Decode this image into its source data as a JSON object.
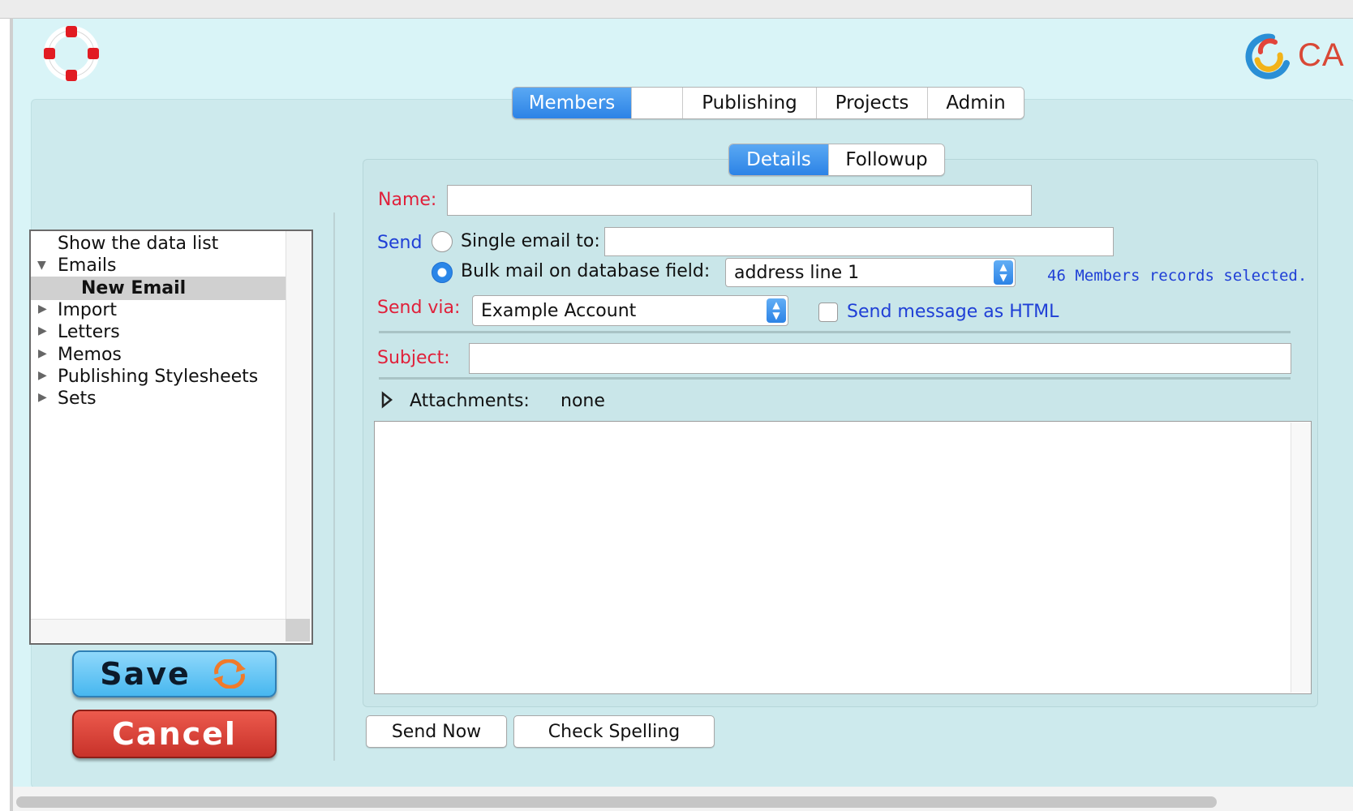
{
  "nav": {
    "tabs": [
      {
        "label": "Members",
        "active": true
      },
      {
        "label": "",
        "active": false
      },
      {
        "label": "Publishing",
        "active": false
      },
      {
        "label": "Projects",
        "active": false
      },
      {
        "label": "Admin",
        "active": false
      }
    ]
  },
  "brand": {
    "text": "CA",
    "icon": "brand-swirl-logo",
    "app_icon": "lifebuoy-icon"
  },
  "subnav": {
    "tabs": [
      {
        "label": "Details",
        "active": true
      },
      {
        "label": "Followup",
        "active": false
      }
    ]
  },
  "tree": {
    "items": [
      {
        "label": "Show the data list",
        "expanded": null
      },
      {
        "label": "Emails",
        "expanded": true
      },
      {
        "label": "New Email",
        "selected": true
      },
      {
        "label": "Import",
        "expanded": false
      },
      {
        "label": "Letters",
        "expanded": false
      },
      {
        "label": "Memos",
        "expanded": false
      },
      {
        "label": "Publishing Stylesheets",
        "expanded": false
      },
      {
        "label": "Sets",
        "expanded": false
      }
    ]
  },
  "form": {
    "name_label": "Name:",
    "name_value": "",
    "send_label": "Send",
    "single_email_label": "Single email to:",
    "single_email_value": "",
    "bulk_label": "Bulk mail on database field:",
    "bulk_field": "address line 1",
    "records_selected": "46 Members records selected.",
    "send_via_label": "Send via:",
    "send_via_value": "Example Account",
    "html_label": "Send message as HTML",
    "html_checked": false,
    "subject_label": "Subject:",
    "subject_value": "",
    "attachments_label": "Attachments:",
    "attachments_value": "none",
    "body": ""
  },
  "buttons": {
    "send_now": "Send Now",
    "check_spelling": "Check Spelling",
    "save": "Save",
    "cancel": "Cancel"
  },
  "colors": {
    "window_bg": "#d9f4f7",
    "label_red": "#e0203a",
    "label_blue": "#1f3fd6",
    "tab_active": "#2c83e6",
    "save_btn": "#47b7ef",
    "cancel_btn": "#c8322a"
  }
}
